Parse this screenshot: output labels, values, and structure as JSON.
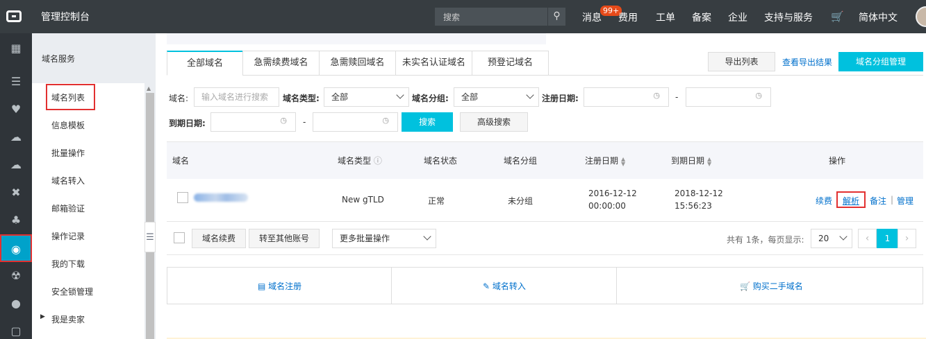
{
  "topbar": {
    "title": "管理控制台",
    "search_placeholder": "搜索",
    "nav": [
      "消息",
      "费用",
      "工单",
      "备案",
      "企业",
      "支持与服务",
      "简体中文"
    ],
    "badge": "99+"
  },
  "sidebar": {
    "section_title": "域名服务",
    "items": [
      "域名列表",
      "信息模板",
      "批量操作",
      "域名转入",
      "邮箱验证",
      "操作记录",
      "我的下载",
      "安全锁管理",
      "我是卖家"
    ]
  },
  "tabs": [
    "全部域名",
    "急需续费域名",
    "急需赎回域名",
    "未实名认证域名",
    "预登记域名"
  ],
  "toolbar": {
    "export_label": "导出列表",
    "view_export_label": "查看导出结果",
    "group_manage_label": "域名分组管理"
  },
  "filters": {
    "domain_label": "域名:",
    "domain_placeholder": "输入域名进行搜索",
    "type_label": "域名类型:",
    "type_value": "全部",
    "group_label": "域名分组:",
    "group_value": "全部",
    "reg_date_label": "注册日期:",
    "exp_date_label": "到期日期:",
    "dash": "-",
    "search_label": "搜索",
    "advanced_label": "高级搜索"
  },
  "table": {
    "headers": [
      "域名",
      "域名类型",
      "域名状态",
      "域名分组",
      "注册日期",
      "到期日期",
      "操作"
    ],
    "rows": [
      {
        "type": "New gTLD",
        "status": "正常",
        "group": "未分组",
        "reg_date": "2016-12-12",
        "reg_time": "00:00:00",
        "exp_date": "2018-12-12",
        "exp_time": "15:56:23",
        "actions": [
          "续费",
          "解析",
          "备注",
          "|",
          "管理"
        ]
      }
    ]
  },
  "bulk": {
    "renew_label": "域名续费",
    "transfer_label": "转至其他账号",
    "more_label": "更多批量操作",
    "total_text": "共有 1条，每页显示:",
    "page_size": "20",
    "current_page": "1"
  },
  "quick_links": [
    "域名注册",
    "域名转入",
    "购买二手域名"
  ],
  "colors": {
    "accent": "#00c1de",
    "highlight": "#e23030",
    "link": "#0070cc"
  }
}
